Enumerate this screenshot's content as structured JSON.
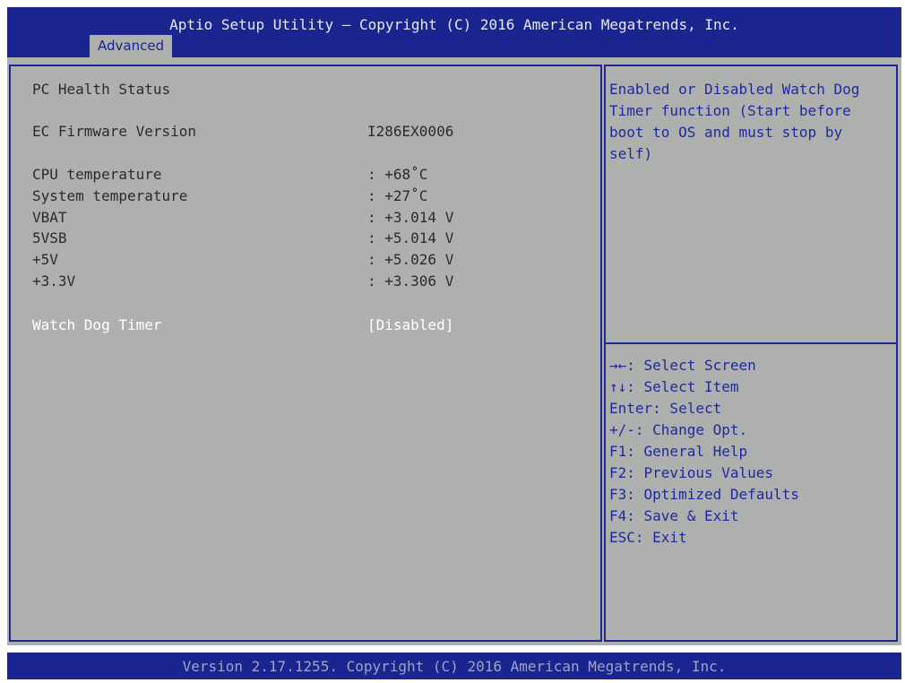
{
  "header": {
    "title": "Aptio Setup Utility – Copyright (C) 2016 American Megatrends, Inc.",
    "tabs": [
      {
        "label": "Advanced"
      }
    ]
  },
  "main": {
    "section_title": "PC Health Status",
    "firmware": {
      "label": "EC Firmware Version",
      "value": "I286EX0006"
    },
    "readings": [
      {
        "label": "CPU temperature",
        "value": ": +68˚C"
      },
      {
        "label": "System temperature",
        "value": ": +27˚C"
      },
      {
        "label": "VBAT",
        "value": ": +3.014 V"
      },
      {
        "label": "5VSB",
        "value": ": +5.014 V"
      },
      {
        "label": "+5V",
        "value": ": +5.026 V"
      },
      {
        "label": "+3.3V",
        "value": ": +3.306 V"
      }
    ],
    "watchdog": {
      "label": "Watch Dog Timer",
      "value": "[Disabled]"
    }
  },
  "help": {
    "text": "Enabled or Disabled Watch Dog Timer function (Start before boot to OS and must stop by self)"
  },
  "keys": [
    "→←: Select Screen",
    "↑↓: Select Item",
    "Enter: Select",
    "+/-: Change Opt.",
    "F1: General Help",
    "F2: Previous Values",
    "F3: Optimized Defaults",
    "F4: Save & Exit",
    "ESC: Exit"
  ],
  "footer": {
    "text": "Version 2.17.1255. Copyright (C) 2016 American Megatrends, Inc."
  },
  "colors": {
    "header_bg": "#1b2590",
    "panel_bg": "#aeb0ae",
    "border": "#1f2890",
    "help_text": "#1f2a9a",
    "selected_text": "#ffffff"
  }
}
